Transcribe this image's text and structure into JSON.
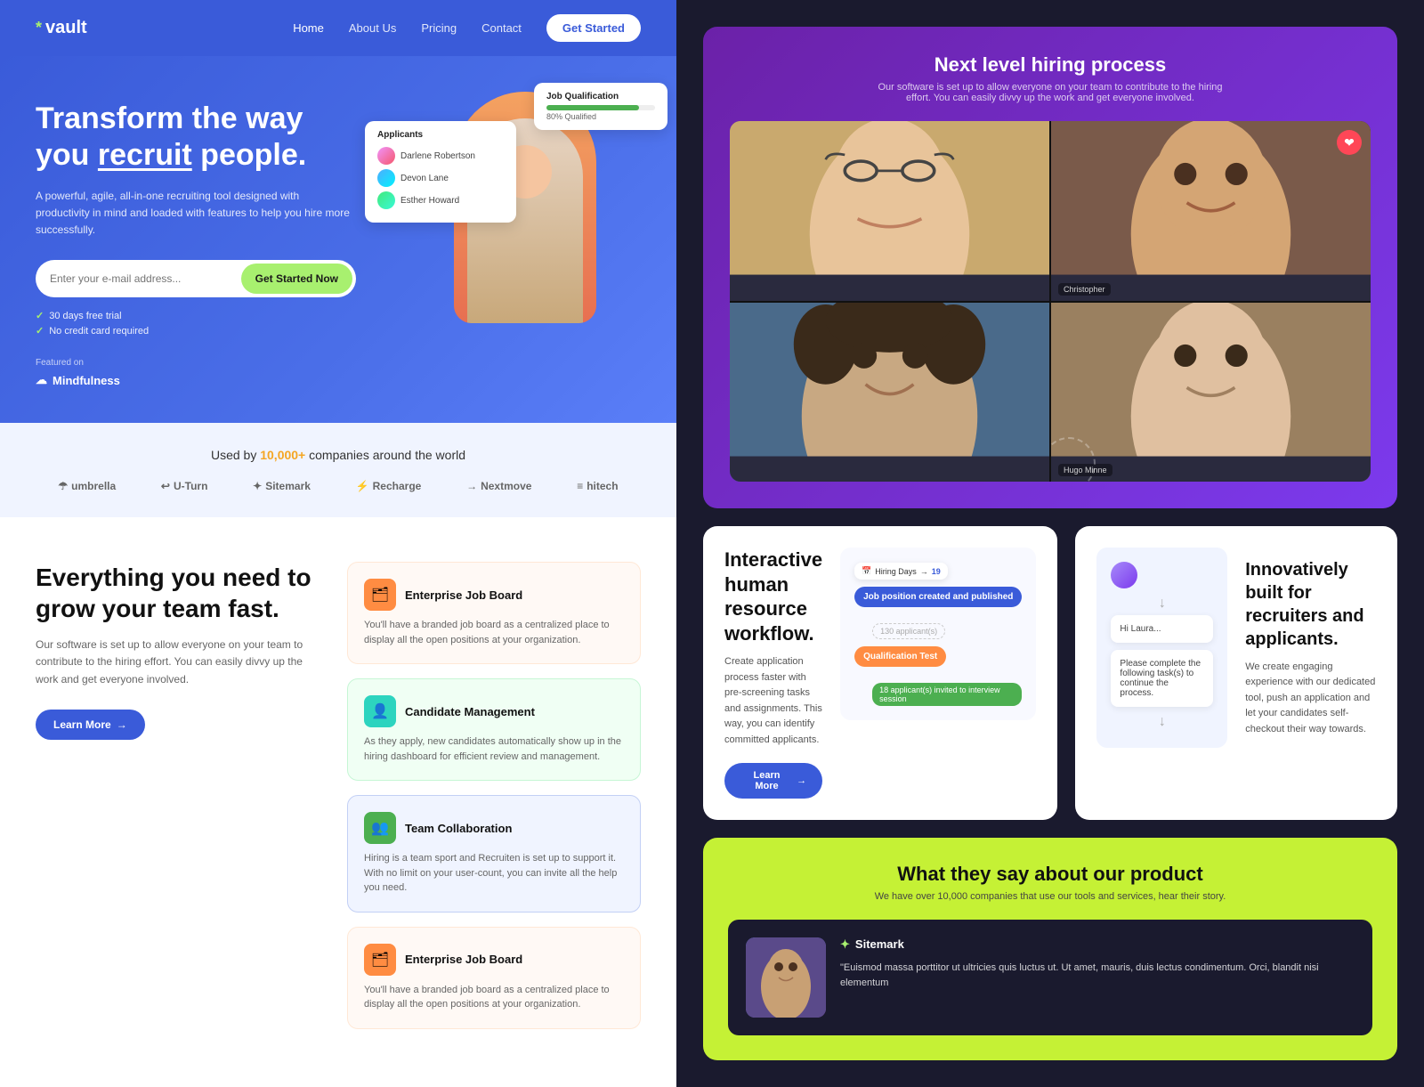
{
  "brand": {
    "logo": "* vault",
    "logo_star": "*"
  },
  "nav": {
    "links": [
      "Home",
      "About Us",
      "Pricing",
      "Contact"
    ],
    "cta_label": "Get Started"
  },
  "hero": {
    "title_line1": "Transform the way",
    "title_line2": "you ",
    "title_highlight": "recruit",
    "title_line3": " people.",
    "subtitle": "A powerful, agile, all-in-one recruiting tool designed with productivity in mind and loaded with features to help you hire more successfully.",
    "input_placeholder": "Enter your e-mail address...",
    "cta_label": "Get Started Now",
    "check1": "30 days free trial",
    "check2": "No credit card required",
    "featured_label": "Featured on",
    "featured_brand": "Mindfulness"
  },
  "hero_card_qualification": {
    "title": "Job Qualification",
    "bar_label": "80% Qualified",
    "bar_pct": 80
  },
  "hero_card_applicants": {
    "title": "Applicants",
    "people": [
      "Darlene Robertson",
      "Devon Lane",
      "Esther Howard"
    ]
  },
  "brands": {
    "title_pre": "Used by ",
    "highlight": "10,000+",
    "title_post": " companies around the world",
    "items": [
      "umbrella",
      "U-Turn",
      "Sitemark",
      "Recharge",
      "Nextmove",
      "hitech"
    ]
  },
  "features": {
    "title": "Everything you need to grow your team fast.",
    "desc": "Our software is set up to allow everyone on your team to contribute to the hiring effort. You can easily divvy up the work and get everyone involved.",
    "learn_more": "Learn More",
    "cards": [
      {
        "id": "enterprise-job-board",
        "icon": "🗂",
        "icon_color": "orange",
        "title": "Enterprise Job Board",
        "desc": "You'll have a branded job board as a centralized place to display all the open positions at your organization.",
        "bg": "orange"
      },
      {
        "id": "candidate-management",
        "icon": "👤",
        "icon_color": "teal",
        "title": "Candidate Management",
        "desc": "As they apply, new candidates automatically show up in the hiring dashboard for efficient review and management.",
        "bg": "green"
      },
      {
        "id": "team-collaboration",
        "icon": "👥",
        "icon_color": "green",
        "title": "Team Collaboration",
        "desc": "Hiring is a team sport and Recruiten is set up to support it. With no limit on your user-count, you can invite all the help you need.",
        "bg": "blue"
      },
      {
        "id": "enterprise-job-board-2",
        "icon": "🗂",
        "icon_color": "orange",
        "title": "Enterprise Job Board",
        "desc": "You'll have a branded job board as a centralized place to display all the open positions at your organization.",
        "bg": "orange"
      }
    ]
  },
  "video_section": {
    "title": "Next level hiring process",
    "subtitle": "Our software is set up to allow everyone on your team to contribute to the hiring effort. You can easily divvy up the work and get everyone involved.",
    "people": [
      "",
      "Christopher",
      "",
      "Hugo Minne"
    ]
  },
  "workflow": {
    "title": "Interactive human resource workflow.",
    "desc": "Create application process faster with pre-screening tasks and assignments. This way, you can identify committed applicants.",
    "learn_more": "Learn More",
    "hiring_days_label": "Hiring Days",
    "nodes": [
      {
        "label": "Job position created and published",
        "color": "blue",
        "connector": "→"
      },
      {
        "label": "130 applicant(s)",
        "color": "gray",
        "connector": "→"
      },
      {
        "label": "Qualification Test",
        "color": "orange",
        "connector": "→"
      },
      {
        "label": "18 applicant(s) invited to interview session",
        "color": "green"
      }
    ]
  },
  "innovative": {
    "title": "Innovatively built for recruiters and applicants.",
    "desc": "We create engaging experience with our dedicated tool, push an application and let your candidates self-checkout their way towards.",
    "chat_greeting": "Hi Laura...",
    "chat_message": "Please complete the following task(s) to continue the process."
  },
  "testimonials": {
    "title": "What they say about our product",
    "subtitle": "We have over 10,000 companies that use our tools and services, hear their story.",
    "card": {
      "brand": "Sitemark",
      "brand_star": "✦",
      "quote": "\"Euismod massa porttitor ut ultricies quis luctus ut. Ut amet, mauris, duis lectus condimentum. Orci, blandit nisi elementum"
    }
  },
  "team_collaboration": {
    "title": "Team Collaboration",
    "subtitle": "Hiring"
  },
  "colors": {
    "accent_blue": "#3a5bd9",
    "accent_green": "#a8f06f",
    "accent_orange": "#ff8c42",
    "accent_lime": "#c5f135"
  }
}
